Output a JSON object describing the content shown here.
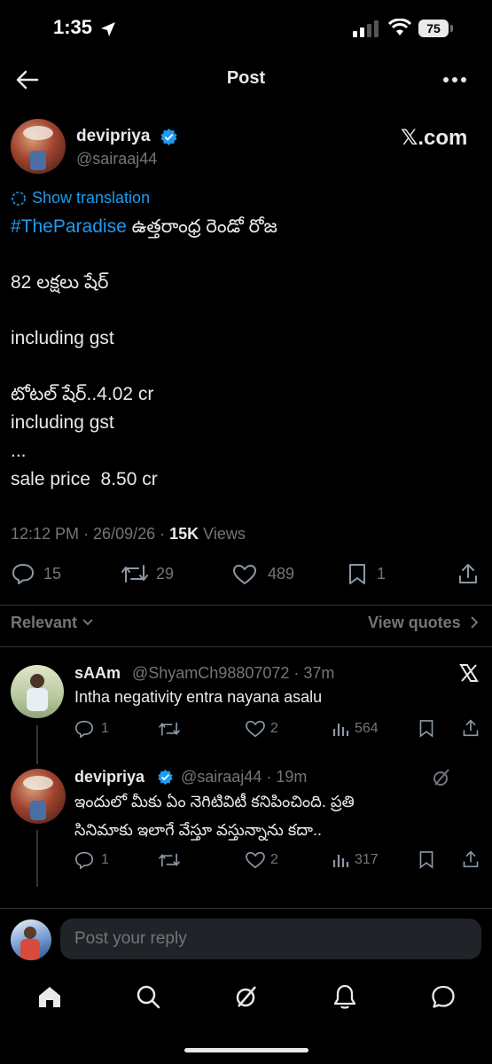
{
  "status_bar": {
    "time": "1:35",
    "battery": "75"
  },
  "header": {
    "title": "Post"
  },
  "post": {
    "author_name": "devipriya",
    "author_handle": "@sairaaj44",
    "watermark": "𝕏.com",
    "show_translation": "Show translation",
    "hashtag": "#TheParadise",
    "line1_rest": " ఉత్తరాంధ్ర రెండో రోజ",
    "lines": [
      "82 లక్షలు షేర్",
      "including gst",
      "టోటల్ షేర్..4.02 cr",
      "including gst",
      "...",
      "sale price  8.50 cr"
    ],
    "time": "12:12 PM · 26/09/26 · ",
    "views_count": "15K",
    "views_label": " Views"
  },
  "actions": {
    "replies": "15",
    "reposts": "29",
    "likes": "489",
    "bookmarks": "1"
  },
  "filter": {
    "sort_label": "Relevant",
    "view_quotes": "View quotes"
  },
  "replies": [
    {
      "name": "sAAm",
      "meta": "@ShyamCh98807072 · 37m",
      "text": "Intha negativity entra nayana asalu",
      "stats": {
        "replies": "1",
        "likes": "2",
        "views": "564"
      }
    },
    {
      "name": "devipriya",
      "meta": "@sairaaj44 · 19m",
      "text_line1": "ఇందులో మీకు ఏం నెగిటివిటీ కనిపించింది. ప్రతి",
      "text_line2": "సినిమాకు ఇలాగే వేస్తూ వస్తున్నాను కదా..",
      "stats": {
        "replies": "1",
        "likes": "2",
        "views": "317"
      }
    }
  ],
  "composer": {
    "placeholder": "Post your reply"
  },
  "colors": {
    "accent": "#1d9bf0",
    "background": "#000000",
    "muted": "#71767b"
  },
  "icons": [
    "back-arrow-icon",
    "more-icon",
    "verified-icon",
    "translate-icon",
    "reply-icon",
    "repost-icon",
    "like-icon",
    "bookmark-icon",
    "share-icon",
    "chevron-down-icon",
    "chevron-right-icon",
    "x-logo-icon",
    "grok-icon",
    "home-icon",
    "search-icon",
    "bell-icon",
    "messages-icon"
  ]
}
